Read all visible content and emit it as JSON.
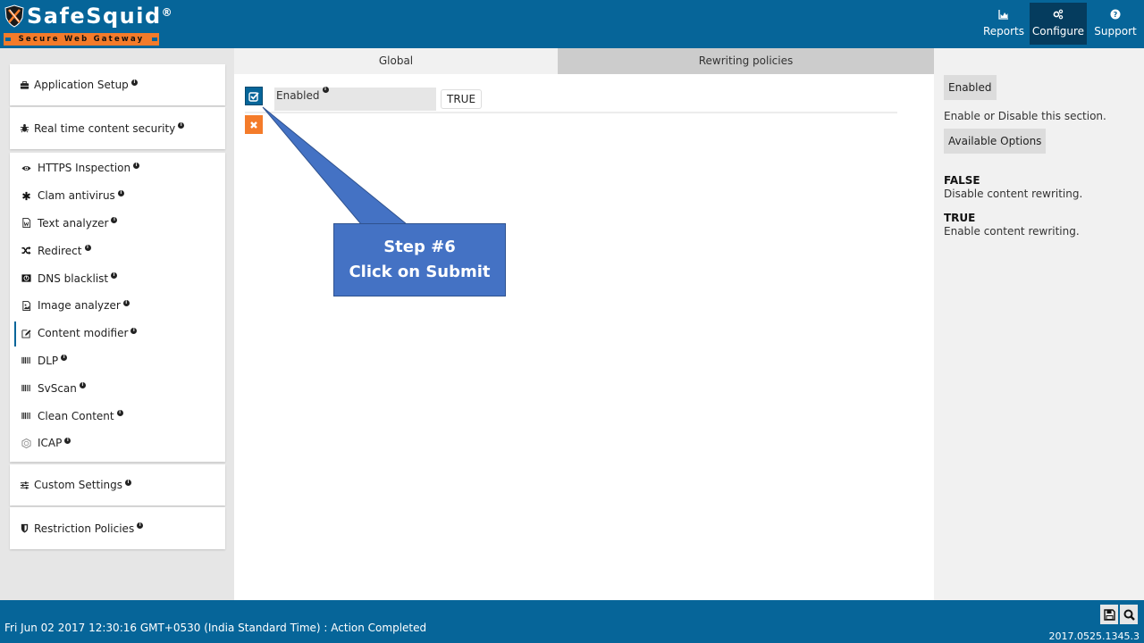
{
  "app": {
    "logo_title": "SafeSquid",
    "logo_reg": "®",
    "logo_subtitle": "Secure Web Gateway"
  },
  "topnav": [
    {
      "label": "Reports",
      "icon": "area-chart-icon",
      "active": false
    },
    {
      "label": "Configure",
      "icon": "cogs-icon",
      "active": true
    },
    {
      "label": "Support",
      "icon": "question-circle-icon",
      "active": false
    }
  ],
  "sidebar": {
    "sections": [
      {
        "label": "Application Setup",
        "icon": "briefcase-icon"
      },
      {
        "label": "Real time content security",
        "icon": "bug-icon"
      },
      {
        "label": "Custom Settings",
        "icon": "sliders-icon"
      },
      {
        "label": "Restriction Policies",
        "icon": "shield-icon"
      }
    ],
    "items": [
      {
        "label": "HTTPS Inspection",
        "icon": "eye-icon"
      },
      {
        "label": "Clam antivirus",
        "icon": "asterisk-icon"
      },
      {
        "label": "Text analyzer",
        "icon": "file-word-icon"
      },
      {
        "label": "Redirect",
        "icon": "random-icon"
      },
      {
        "label": "DNS blacklist",
        "icon": "dns-icon"
      },
      {
        "label": "Image analyzer",
        "icon": "file-image-icon"
      },
      {
        "label": "Content modifier",
        "icon": "edit-icon",
        "active": true
      },
      {
        "label": "DLP",
        "icon": "barcode-icon"
      },
      {
        "label": "SvScan",
        "icon": "barcode-icon"
      },
      {
        "label": "Clean Content",
        "icon": "barcode-icon"
      },
      {
        "label": "ICAP",
        "icon": "icap-icon"
      }
    ],
    "info_glyph": "i"
  },
  "main": {
    "tabs": [
      {
        "label": "Global",
        "active": true
      },
      {
        "label": "Rewriting policies",
        "active": false
      }
    ],
    "field": {
      "label": "Enabled",
      "value": "TRUE"
    }
  },
  "help": {
    "title_chip": "Enabled",
    "description": "Enable or Disable this section.",
    "options_chip": "Available Options",
    "options": [
      {
        "name": "FALSE",
        "desc": "Disable content rewriting."
      },
      {
        "name": "TRUE",
        "desc": "Enable content rewriting."
      }
    ]
  },
  "callout": {
    "line1": "Step #6",
    "line2": "Click on Submit",
    "color": "#4472c4"
  },
  "footer": {
    "status": "Fri Jun 02 2017 12:30:16 GMT+0530 (India Standard Time) : Action Completed",
    "version": "2017.0525.1345.3"
  },
  "colors": {
    "brand": "#066599",
    "accent": "#f47b2a",
    "nav_active": "#053c5e"
  }
}
